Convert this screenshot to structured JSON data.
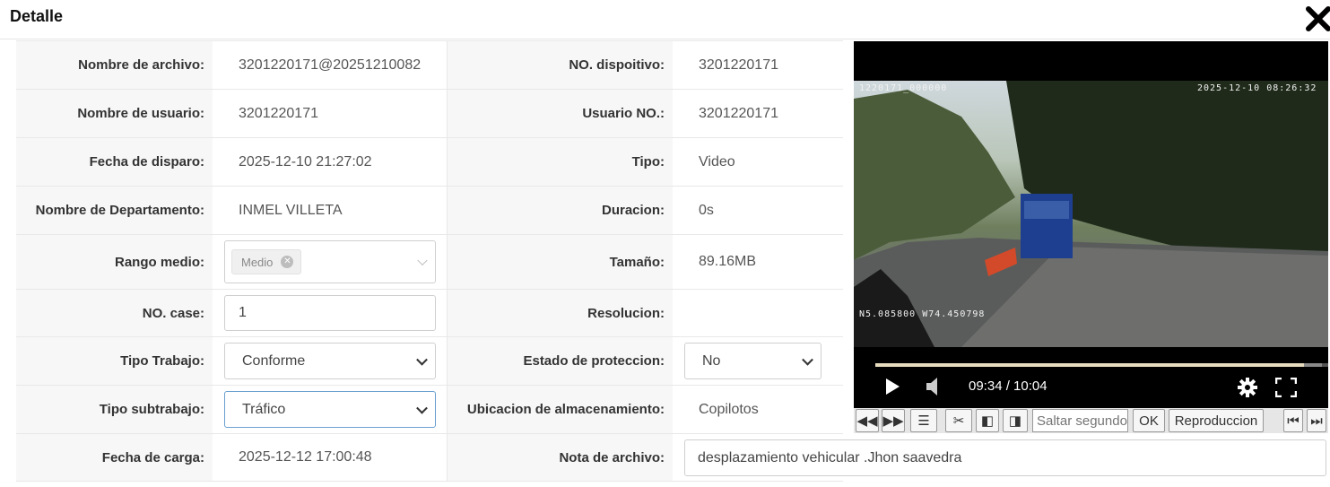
{
  "dialog": {
    "title": "Detalle",
    "close_icon": "close-icon"
  },
  "fields": {
    "file_name_label": "Nombre de archivo:",
    "file_name_value": "3201220171@20251210082",
    "device_no_label": "NO. dispoitivo:",
    "device_no_value": "3201220171",
    "user_name_label": "Nombre de usuario:",
    "user_name_value": "3201220171",
    "user_no_label": "Usuario NO.:",
    "user_no_value": "3201220171",
    "trigger_date_label": "Fecha de disparo:",
    "trigger_date_value": "2025-12-10 21:27:02",
    "type_label": "Tipo:",
    "type_value": "Video",
    "department_label": "Nombre de Departamento:",
    "department_value": "INMEL VILLETA",
    "duration_label": "Duracion:",
    "duration_value": "0s",
    "media_range_label": "Rango medio:",
    "media_range_tag": "Medio",
    "size_label": "Tamaño:",
    "size_value": "89.16MB",
    "case_no_label": "NO. case:",
    "case_no_value": "1",
    "resolution_label": "Resolucion:",
    "resolution_value": "",
    "work_type_label": "Tipo Trabajo:",
    "work_type_value": "Conforme",
    "protection_label": "Estado de proteccion:",
    "protection_value": "No",
    "subwork_type_label": "Tipo subtrabajo:",
    "subwork_type_value": "Tráfico",
    "storage_label": "Ubicacion de almacenamiento:",
    "storage_value": "Copilotos",
    "upload_date_label": "Fecha de carga:",
    "upload_date_value": "2025-12-12 17:00:48",
    "file_note_label": "Nota de archivo:",
    "file_note_value": "desplazamiento vehicular .Jhon saavedra"
  },
  "video": {
    "osd_left": "1220171_000000",
    "osd_right": "2025-12-10 08:26:32",
    "osd_gps": "N5.085800 W74.450798",
    "time": "09:34 / 10:04",
    "progress_fraction": 0.95,
    "icons": [
      "play-icon",
      "volume-icon",
      "settings-icon",
      "fullscreen-icon"
    ]
  },
  "toolbar": {
    "seek_placeholder": "Saltar segundo",
    "ok_label": "OK",
    "playback_label": "Reproduccion"
  },
  "colors": {
    "video_bg": "#000000",
    "label_bg": "#f7f7f7",
    "focus_border": "#6a9fd0",
    "progress": "#e8dcc0"
  }
}
